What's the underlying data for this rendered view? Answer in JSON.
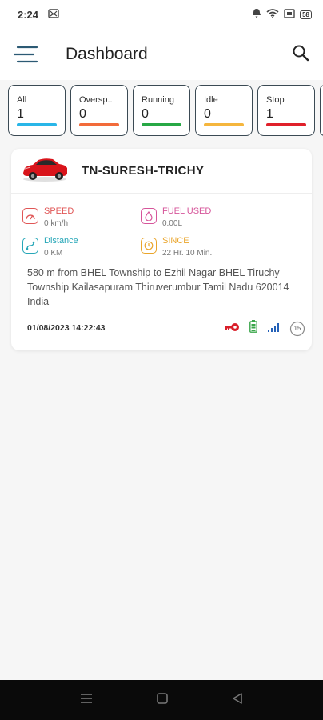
{
  "status_bar": {
    "time": "2:24",
    "battery": "58"
  },
  "app_bar": {
    "title": "Dashboard"
  },
  "filters": [
    {
      "label": "All",
      "count": "1",
      "color": "#29b6e8"
    },
    {
      "label": "Oversp..",
      "count": "0",
      "color": "#f26b3a"
    },
    {
      "label": "Running",
      "count": "0",
      "color": "#27a845"
    },
    {
      "label": "Idle",
      "count": "0",
      "color": "#f5b63d"
    },
    {
      "label": "Stop",
      "count": "1",
      "color": "#e0202a"
    }
  ],
  "vehicle": {
    "name": "TN-SURESH-TRICHY",
    "speed": {
      "label": "SPEED",
      "value": "0 km/h",
      "color": "#e05656"
    },
    "fuel": {
      "label": "FUEL USED",
      "value": "0.00L",
      "color": "#d6559a"
    },
    "distance": {
      "label": "Distance",
      "value": "0 KM",
      "color": "#27a7b8"
    },
    "since": {
      "label": "SINCE",
      "value": "22 Hr. 10 Min.",
      "color": "#eaa52b"
    },
    "address": "580 m from BHEL Township to Ezhil Nagar BHEL Tiruchy Township Kailasapuram Thiruverumbur Tamil Nadu 620014 India",
    "datetime": "01/08/2023 14:22:43",
    "badge": "15"
  }
}
